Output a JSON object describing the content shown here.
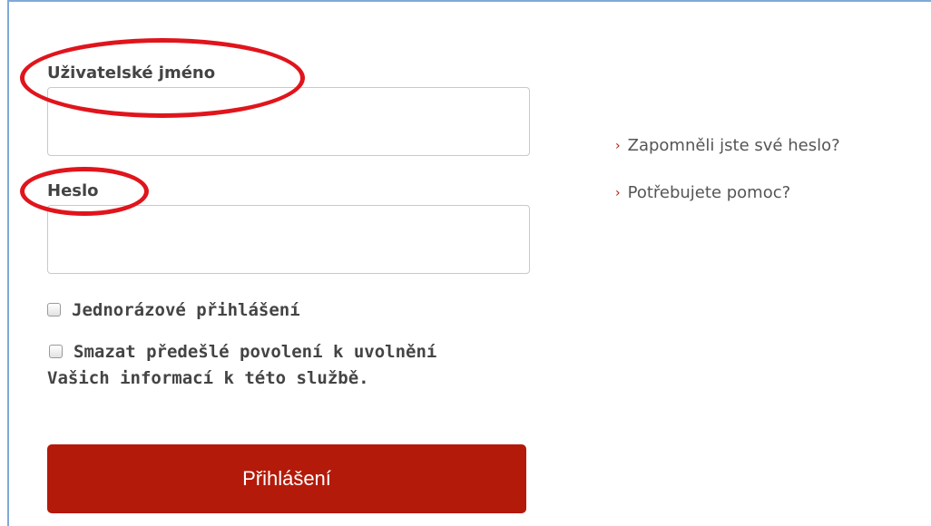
{
  "form": {
    "username_label": "Uživatelské jméno",
    "username_value": "",
    "password_label": "Heslo",
    "password_value": "",
    "one_time_login_label": "Jednorázové přihlášení",
    "one_time_login_checked": false,
    "clear_consent_label": "Smazat předešlé povolení k uvolnění Vašich informací k této službě.",
    "clear_consent_checked": false,
    "login_button_label": "Přihlášení"
  },
  "links": {
    "forgot_password": "Zapomněli jste své heslo?",
    "need_help": "Potřebujete pomoc?",
    "chevron": "›"
  },
  "annotations": {
    "highlight_color": "#e0151c"
  },
  "colors": {
    "button": "#b31a0a",
    "frame": "#7fa9d9"
  }
}
